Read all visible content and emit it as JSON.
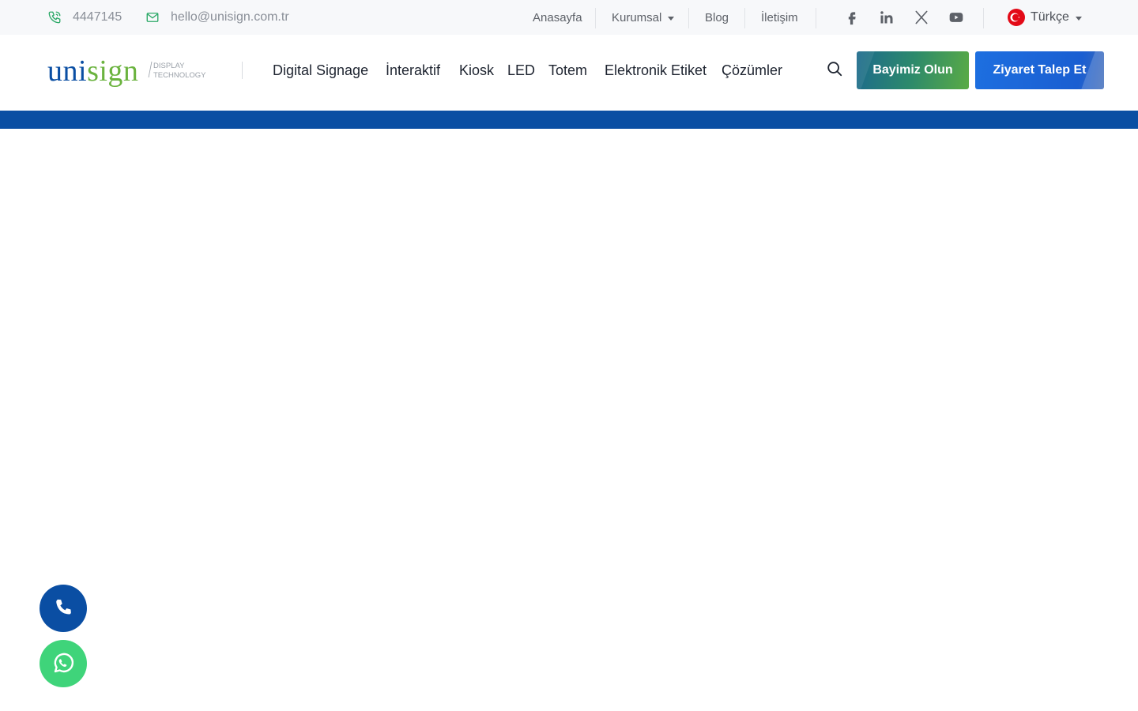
{
  "topbar": {
    "phone": "4447145",
    "email": "hello@unisign.com.tr",
    "nav": [
      {
        "label": "Anasayfa"
      },
      {
        "label": "Kurumsal",
        "dropdown": true
      },
      {
        "label": "Blog"
      },
      {
        "label": "İletişim"
      }
    ],
    "social_icons": [
      "facebook-icon",
      "linkedin-icon",
      "x-twitter-icon",
      "youtube-icon"
    ],
    "language": "Türkçe"
  },
  "header": {
    "logo": {
      "brand_a": "uni",
      "brand_b": "sign",
      "tagline_1": "DISPLAY",
      "tagline_2": "TECHNOLOGY"
    },
    "nav": [
      {
        "label": "Digital Signage"
      },
      {
        "label": "İnteraktif"
      },
      {
        "label": "Kiosk"
      },
      {
        "label": "LED"
      },
      {
        "label": "Totem"
      },
      {
        "label": "Elektronik Etiket"
      },
      {
        "label": "Çözümler"
      }
    ],
    "dealer_button": "Bayimiz Olun",
    "visit_button": "Ziyaret Talep Et"
  },
  "colors": {
    "brand_blue": "#0a4ea3",
    "brand_green": "#6bb33f",
    "whatsapp_green": "#3fd47a",
    "icon_green": "#2aa866"
  }
}
